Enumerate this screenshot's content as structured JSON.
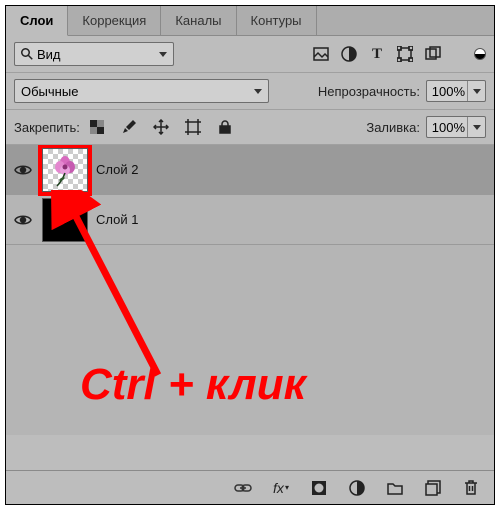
{
  "tabs": {
    "layers": "Слои",
    "adj": "Коррекция",
    "channels": "Каналы",
    "paths": "Контуры"
  },
  "kind": {
    "label": "Вид"
  },
  "blend": {
    "mode": "Обычные",
    "opacity_label": "Непрозрачность:",
    "opacity": "100%"
  },
  "lock": {
    "label": "Закрепить:",
    "fill_label": "Заливка:",
    "fill": "100%"
  },
  "layers": {
    "0": {
      "name": "Слой 2"
    },
    "1": {
      "name": "Слой 1"
    }
  },
  "annotation": "Ctrl + клик"
}
